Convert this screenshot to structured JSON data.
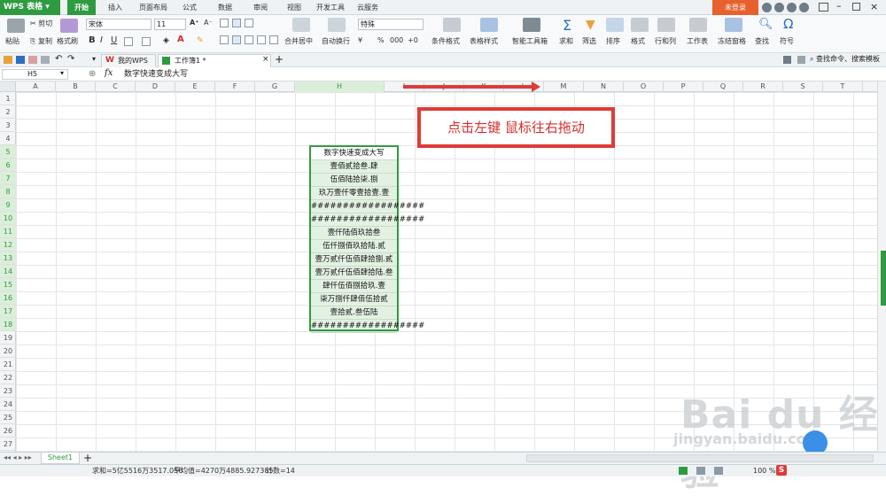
{
  "title_bar": {
    "app_name": "WPS 表格",
    "tabs": [
      "开始",
      "插入",
      "页面布局",
      "公式",
      "数据",
      "审阅",
      "视图",
      "开发工具",
      "云服务"
    ],
    "login": "未登录"
  },
  "ribbon": {
    "paste": "粘贴",
    "cut": "剪切",
    "copy": "复制",
    "format_painter": "格式刷",
    "font_name": "宋体",
    "font_size": "11",
    "bold": "B",
    "italic": "I",
    "underline": "U",
    "merge": "合并居中",
    "wrap": "自动换行",
    "number_format": "特殊",
    "percent": "%",
    "thousands": "000",
    "conditional": "条件格式",
    "table_style": "表格样式",
    "smart_tools": "智能工具箱",
    "sum": "求和",
    "filter": "筛选",
    "sort": "排序",
    "format": "格式",
    "rowcol": "行和列",
    "worksheet": "工作表",
    "freeze": "冻结窗格",
    "find": "查找",
    "symbol": "符号"
  },
  "doc_tabs": {
    "my_wps": "我的WPS",
    "workbook": "工作簿1 *",
    "search_hint": "查找命令、搜索模板"
  },
  "formula_bar": {
    "name_box": "H5",
    "fx": "fx",
    "content": "数字快速变成大写"
  },
  "columns": [
    "A",
    "B",
    "C",
    "D",
    "E",
    "F",
    "G",
    "H",
    "I",
    "J",
    "K",
    "L",
    "M",
    "N",
    "O",
    "P",
    "Q",
    "R",
    "S",
    "T"
  ],
  "rows": [
    "1",
    "2",
    "3",
    "4",
    "5",
    "6",
    "7",
    "8",
    "9",
    "10",
    "11",
    "12",
    "13",
    "14",
    "15",
    "16",
    "17",
    "18",
    "19",
    "20",
    "21",
    "22",
    "23",
    "24",
    "25",
    "26",
    "27"
  ],
  "cells_h": [
    "数字快速变成大写",
    "壹佰贰拾叁.肆",
    "伍佰陆拾柒.捌",
    "玖万壹仟零壹拾壹.壹",
    "##################",
    "##################",
    "壹仟陆佰玖拾叁",
    "伍仟捌佰玖拾陆.贰",
    "壹万贰仟伍佰肆拾捌.贰",
    "壹万贰仟伍佰肆拾陆.叁",
    "肆仟伍佰捌拾玖.壹",
    "柒万捌仟肆佰伍拾贰",
    "壹拾贰.叁伍陆",
    "##################"
  ],
  "annotation": "点击左键 鼠标往右拖动",
  "sheet_tab": "Sheet1",
  "status": {
    "sum": "求和=5亿5516万3517.056",
    "average": "平均值=4270万4885.927385",
    "count": "计数=14",
    "zoom": "100 %"
  },
  "watermark": {
    "main": "Bai du 经验",
    "sub": "jingyan.baidu.com"
  }
}
